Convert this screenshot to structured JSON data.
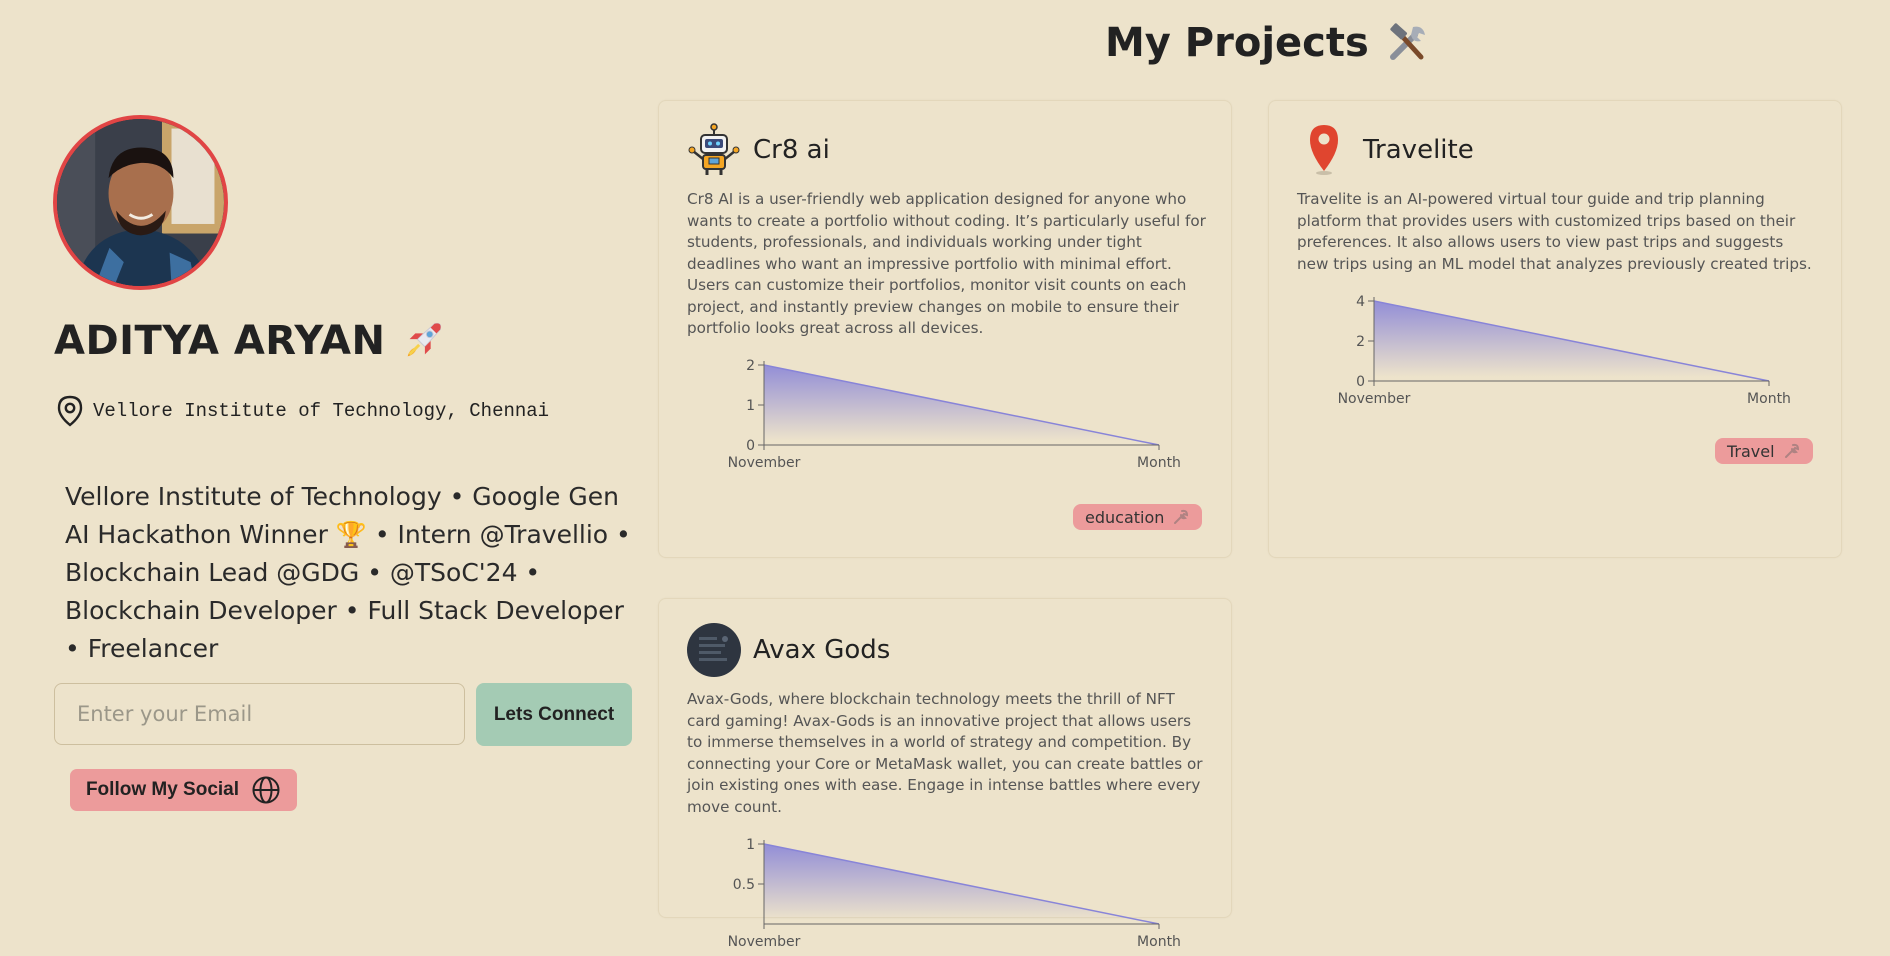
{
  "profile": {
    "name": "ADITYA ARYAN",
    "location": "Vellore Institute of Technology, Chennai",
    "bio": "Vellore Institute of Technology • Google Gen AI Hackathon Winner 🏆 • Intern @Travellio • Blockchain Lead @GDG • @TSoC'24 • Blockchain Developer • Full Stack Developer • Freelancer",
    "email_placeholder": "Enter your Email",
    "connect_label": "Lets Connect",
    "social_label": "Follow My Social"
  },
  "projects_title": "My Projects",
  "projects": [
    {
      "title": "Cr8 ai",
      "icon": "robot-icon",
      "description": "Cr8 AI is a user-friendly web application designed for anyone who wants to create a portfolio without coding. It’s particularly useful for students, professionals, and individuals working under tight deadlines who want an impressive portfolio with minimal effort. Users can customize their portfolios, monitor visit counts on each project, and instantly preview changes on mobile to ensure their portfolio looks great across all devices.",
      "tag": "education",
      "chart_data": {
        "type": "area",
        "x": [
          "November",
          "Month"
        ],
        "values": [
          2,
          0
        ],
        "yticks": [
          "0",
          "1",
          "2"
        ],
        "ylim": [
          0,
          2
        ]
      }
    },
    {
      "title": "Travelite",
      "icon": "map-pin-icon",
      "description": "Travelite is an AI-powered virtual tour guide and trip planning platform that provides users with customized trips based on their preferences. It also allows users to view past trips and suggests new trips using an ML model that analyzes previously created trips.",
      "tag": "Travel",
      "chart_data": {
        "type": "area",
        "x": [
          "November",
          "Month"
        ],
        "values": [
          4,
          0
        ],
        "yticks": [
          "0",
          "2",
          "4"
        ],
        "ylim": [
          0,
          4
        ]
      }
    },
    {
      "title": "Avax Gods",
      "icon": "avax-avatar-icon",
      "description": "Avax-Gods, where blockchain technology meets the thrill of NFT card gaming! Avax-Gods is an innovative project that allows users to immerse themselves in a world of strategy and competition. By connecting your Core or MetaMask wallet, you can create battles or join existing ones with ease. Engage in intense battles where every move count.",
      "tag": "",
      "chart_data": {
        "type": "area",
        "x": [
          "November",
          "Month"
        ],
        "values": [
          1,
          0
        ],
        "yticks": [
          "0.5",
          "1"
        ],
        "ylim": [
          0,
          1
        ]
      }
    }
  ],
  "colors": {
    "background": "#ede3cb",
    "accent_green": "#a4cbb4",
    "accent_pink": "#ec9b9b",
    "avatar_border": "#e14545",
    "chart_stroke": "#8884d8"
  }
}
